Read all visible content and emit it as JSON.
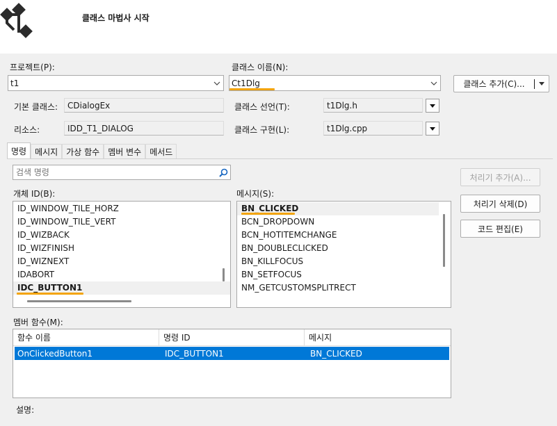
{
  "header": {
    "title": "클래스 마법사 시작"
  },
  "project": {
    "label": "프로젝트(P):",
    "value": "t1"
  },
  "class_name": {
    "label": "클래스 이름(N):",
    "value": "Ct1Dlg"
  },
  "add_class_button": "클래스 추가(C)...",
  "base_class": {
    "label": "기본 클래스:",
    "value": "CDialogEx"
  },
  "class_declaration": {
    "label": "클래스 선언(T):",
    "value": "t1Dlg.h"
  },
  "resource": {
    "label": "리소스:",
    "value": "IDD_T1_DIALOG"
  },
  "class_implementation": {
    "label": "클래스 구현(L):",
    "value": "t1Dlg.cpp"
  },
  "tabs": [
    {
      "label": "명령"
    },
    {
      "label": "메시지"
    },
    {
      "label": "가상 함수"
    },
    {
      "label": "멤버 변수"
    },
    {
      "label": "메서드"
    }
  ],
  "search": {
    "placeholder": "검색 명령"
  },
  "object_ids": {
    "label": "개체 ID(B):",
    "items": [
      "ID_WINDOW_TILE_HORZ",
      "ID_WINDOW_TILE_VERT",
      "ID_WIZBACK",
      "ID_WIZFINISH",
      "ID_WIZNEXT",
      "IDABORT",
      "IDC_BUTTON1"
    ],
    "selected": "IDC_BUTTON1"
  },
  "messages": {
    "label": "메시지(S):",
    "items": [
      "BN_CLICKED",
      "BCN_DROPDOWN",
      "BCN_HOTITEMCHANGE",
      "BN_DOUBLECLICKED",
      "BN_KILLFOCUS",
      "BN_SETFOCUS",
      "NM_GETCUSTOMSPLITRECT"
    ],
    "selected": "BN_CLICKED"
  },
  "buttons": {
    "add_handler": "처리기 추가(A)...",
    "delete_handler": "처리기 삭제(D)",
    "edit_code": "코드 편집(E)"
  },
  "member_functions": {
    "label": "멤버 함수(M):",
    "columns": [
      "함수 이름",
      "명령 ID",
      "메시지"
    ],
    "rows": [
      [
        "OnClickedButton1",
        "IDC_BUTTON1",
        "BN_CLICKED"
      ]
    ]
  },
  "description": {
    "label": "설명:"
  },
  "colors": {
    "accent_underline": "#f3a40b",
    "selection": "#0078d7"
  }
}
